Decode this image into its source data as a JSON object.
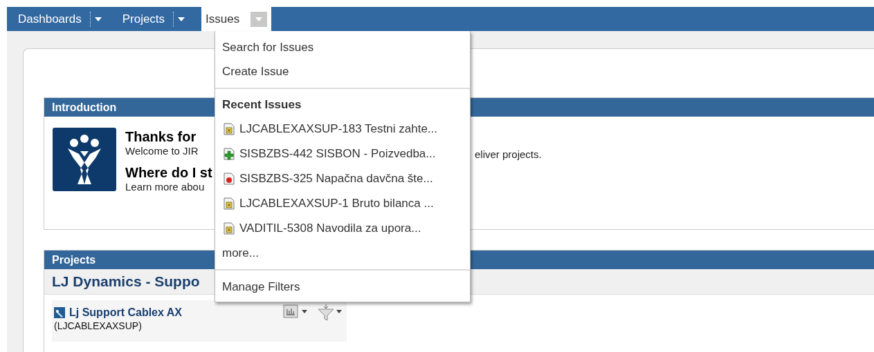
{
  "nav": [
    {
      "label": "Dashboards",
      "selected": false
    },
    {
      "label": "Projects",
      "selected": false
    },
    {
      "label": "Issues",
      "selected": true
    }
  ],
  "dropdown": {
    "actions": [
      "Search for Issues",
      "Create Issue"
    ],
    "recent_heading": "Recent Issues",
    "recent": [
      {
        "kind": "task",
        "label": "LJCABLEXAXSUP-183 Testni zahte..."
      },
      {
        "kind": "new-feature",
        "label": "SISBZBS-442 SISBON - Poizvedba..."
      },
      {
        "kind": "bug",
        "label": "SISBZBS-325 Napačna davčna šte..."
      },
      {
        "kind": "task",
        "label": "LJCABLEXAXSUP-1 Bruto bilanca ..."
      },
      {
        "kind": "task",
        "label": "VADITIL-5308 Navodila za upora..."
      }
    ],
    "more": "more...",
    "manage": "Manage Filters"
  },
  "introduction": {
    "title": "Introduction",
    "heading": "Thanks for",
    "welcome": "Welcome to JIR",
    "welcome_rest": "eliver projects.",
    "subheading": "Where do I st",
    "learn": "Learn more abou"
  },
  "projects": {
    "title": "Projects",
    "category": "LJ Dynamics - Suppo",
    "project": {
      "name": "Lj Support Cablex AX",
      "key": "(LJCABLEXAXSUP)"
    }
  }
}
